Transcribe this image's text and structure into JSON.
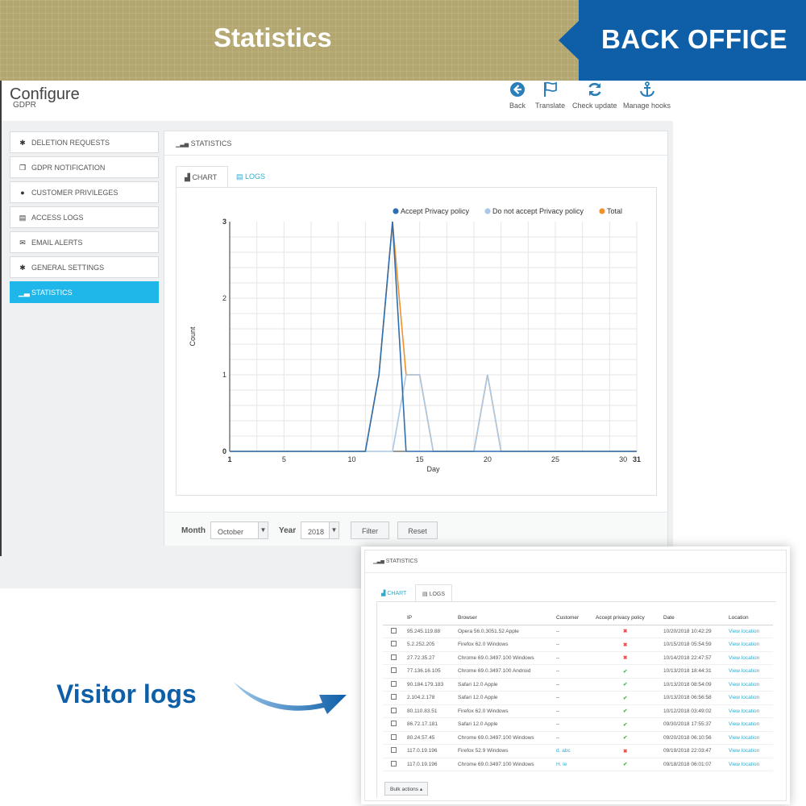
{
  "banner": {
    "title": "Statistics",
    "badge": "BACK OFFICE",
    "bg_color": "#b3a66e",
    "badge_color": "#0e5fa7"
  },
  "page": {
    "title": "Configure",
    "subtitle": "GDPR"
  },
  "toolbar": [
    {
      "label": "Back",
      "icon": "arrow-left-circle-icon"
    },
    {
      "label": "Translate",
      "icon": "flag-icon"
    },
    {
      "label": "Check update",
      "icon": "refresh-icon"
    },
    {
      "label": "Manage hooks",
      "icon": "anchor-icon"
    }
  ],
  "menu": [
    {
      "label": "DELETION REQUESTS",
      "icon": "gear-icon",
      "active": false
    },
    {
      "label": "GDPR NOTIFICATION",
      "icon": "copy-icon",
      "active": false
    },
    {
      "label": "CUSTOMER PRIVILEGES",
      "icon": "user-icon",
      "active": false
    },
    {
      "label": "ACCESS LOGS",
      "icon": "file-icon",
      "active": false
    },
    {
      "label": "EMAIL ALERTS",
      "icon": "envelope-icon",
      "active": false
    },
    {
      "label": "GENERAL SETTINGS",
      "icon": "gear-icon",
      "active": false
    },
    {
      "label": "STATISTICS",
      "icon": "bar-chart-icon",
      "active": true
    }
  ],
  "panel": {
    "heading": "STATISTICS",
    "tabs": {
      "chart": "CHART",
      "logs": "LOGS"
    }
  },
  "filter": {
    "month_label": "Month",
    "month_value": "October",
    "year_label": "Year",
    "year_value": "2018",
    "filter_button": "Filter",
    "reset_button": "Reset"
  },
  "chart_data": {
    "type": "line",
    "xlabel": "Day",
    "ylabel": "Count",
    "xlim": [
      1,
      31
    ],
    "ylim": [
      0,
      3
    ],
    "xticks": [
      1,
      5,
      10,
      15,
      20,
      25,
      30,
      31
    ],
    "yticks": [
      0,
      1,
      2,
      3
    ],
    "grid": true,
    "legend_position": "top-right",
    "series": [
      {
        "name": "Accept Privacy policy",
        "color": "#2d6fb0",
        "points": [
          [
            1,
            0
          ],
          [
            11,
            0
          ],
          [
            12,
            1
          ],
          [
            13,
            3
          ],
          [
            14,
            0
          ],
          [
            31,
            0
          ]
        ]
      },
      {
        "name": "Do not accept Privacy policy",
        "color": "#a9c7e6",
        "points": [
          [
            1,
            0
          ],
          [
            13,
            0
          ],
          [
            14,
            1
          ],
          [
            15,
            1
          ],
          [
            16,
            0
          ],
          [
            19,
            0
          ],
          [
            20,
            1
          ],
          [
            21,
            0
          ],
          [
            31,
            0
          ]
        ]
      },
      {
        "name": "Total",
        "color": "#f0912b",
        "points": [
          [
            1,
            0
          ],
          [
            11,
            0
          ],
          [
            12,
            1
          ],
          [
            13,
            3
          ],
          [
            14,
            1
          ],
          [
            15,
            1
          ],
          [
            16,
            0
          ],
          [
            19,
            0
          ],
          [
            20,
            1
          ],
          [
            21,
            0
          ],
          [
            31,
            0
          ]
        ]
      }
    ]
  },
  "visitor_logs_caption": "Visitor logs",
  "logs_card": {
    "heading": "STATISTICS",
    "tabs": {
      "chart": "CHART",
      "logs": "LOGS"
    },
    "columns": [
      "IP",
      "Browser",
      "Customer",
      "Accept privacy policy",
      "Date",
      "Location"
    ],
    "rows": [
      {
        "ip": "95.245.119.88",
        "browser": "Opera 56.0.3051.52 Apple",
        "customer": "--",
        "accept": false,
        "date": "10/20/2018 10:42:29",
        "location": "View location"
      },
      {
        "ip": "5.2.252.205",
        "browser": "Firefox 62.0 Windows",
        "customer": "--",
        "accept": false,
        "date": "10/15/2018 05:54:59",
        "location": "View location"
      },
      {
        "ip": "27.72.35.27",
        "browser": "Chrome 69.0.3497.100 Windows",
        "customer": "--",
        "accept": false,
        "date": "10/14/2018 22:47:57",
        "location": "View location"
      },
      {
        "ip": "77.136.16.105",
        "browser": "Chrome 69.0.3497.100 Android",
        "customer": "--",
        "accept": true,
        "date": "10/13/2018 18:44:31",
        "location": "View location"
      },
      {
        "ip": "90.184.179.183",
        "browser": "Safari 12.0 Apple",
        "customer": "--",
        "accept": true,
        "date": "10/13/2018 08:54:09",
        "location": "View location"
      },
      {
        "ip": "2.104.2.178",
        "browser": "Safari 12.0 Apple",
        "customer": "--",
        "accept": true,
        "date": "10/13/2018 06:56:58",
        "location": "View location"
      },
      {
        "ip": "80.110.83.51",
        "browser": "Firefox 62.0 Windows",
        "customer": "--",
        "accept": true,
        "date": "10/12/2018 03:49:02",
        "location": "View location"
      },
      {
        "ip": "86.72.17.181",
        "browser": "Safari 12.0 Apple",
        "customer": "--",
        "accept": true,
        "date": "09/30/2018 17:55:37",
        "location": "View location"
      },
      {
        "ip": "80.24.57.45",
        "browser": "Chrome 69.0.3497.100 Windows",
        "customer": "--",
        "accept": true,
        "date": "09/20/2018 06:10:56",
        "location": "View location"
      },
      {
        "ip": "117.0.19.196",
        "browser": "Firefox 52.9 Windows",
        "customer": "d. abc",
        "accept": false,
        "date": "09/19/2018 22:03:47",
        "location": "View location"
      },
      {
        "ip": "117.0.19.196",
        "browser": "Chrome 69.0.3497.100 Windows",
        "customer": "H. le",
        "accept": true,
        "date": "09/18/2018 06:01:07",
        "location": "View location"
      }
    ],
    "bulk_actions": "Bulk actions ▴"
  }
}
